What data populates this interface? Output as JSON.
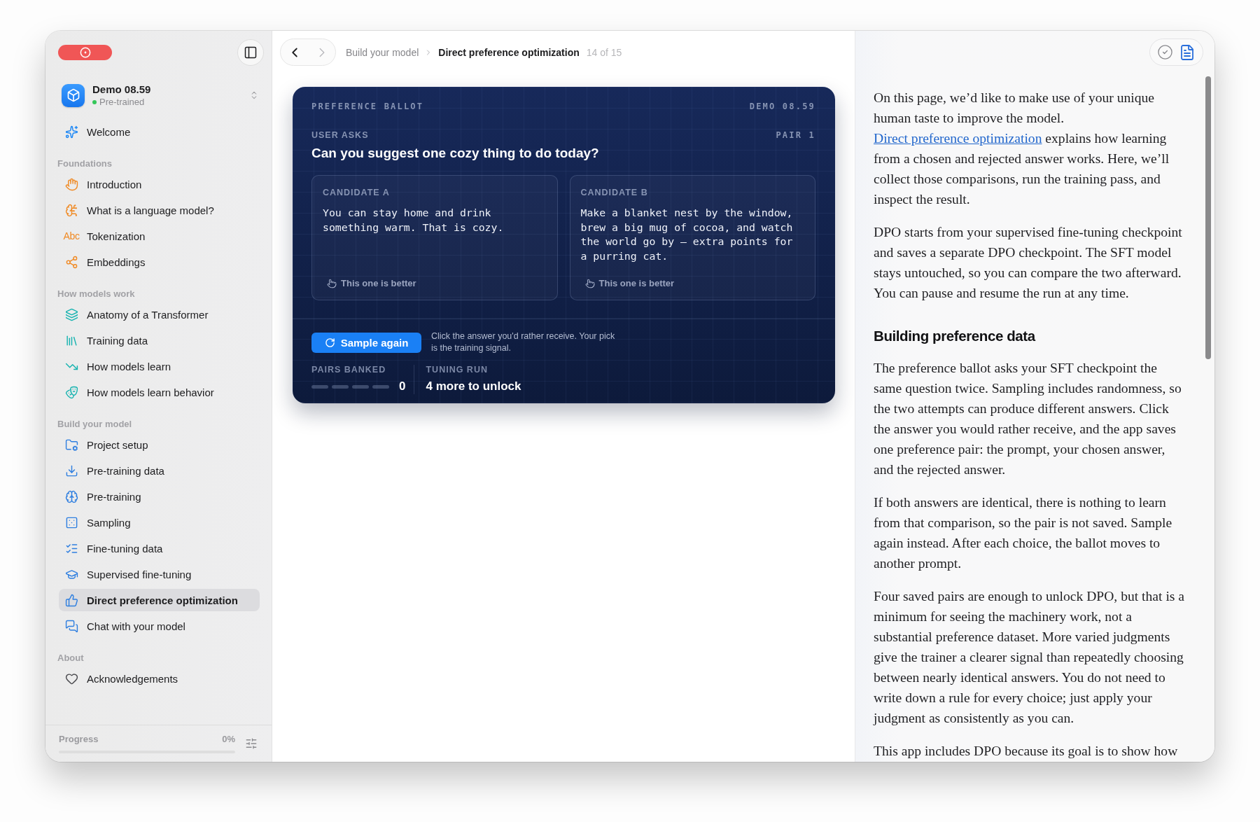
{
  "sidebar": {
    "project": {
      "name": "Demo 08.59",
      "status": {
        "label": "Pre-trained",
        "color": "#34c759"
      }
    },
    "welcome": {
      "label": "Welcome",
      "selected": false
    },
    "sections": [
      {
        "title": "Foundations",
        "color": "#f08a24",
        "items": [
          {
            "label": "Introduction",
            "selected": false
          },
          {
            "label": "What is a language model?",
            "selected": false
          },
          {
            "label": "Tokenization",
            "icon_text": "Abc",
            "selected": false
          },
          {
            "label": "Embeddings",
            "selected": false
          }
        ]
      },
      {
        "title": "How models work",
        "color": "#16b3b0",
        "items": [
          {
            "label": "Anatomy of a Transformer",
            "selected": false
          },
          {
            "label": "Training data",
            "selected": false
          },
          {
            "label": "How models learn",
            "selected": false
          },
          {
            "label": "How models learn behavior",
            "selected": false
          }
        ]
      },
      {
        "title": "Build your model",
        "color": "#2f7fe0",
        "items": [
          {
            "label": "Project setup",
            "selected": false
          },
          {
            "label": "Pre-training data",
            "selected": false
          },
          {
            "label": "Pre-training",
            "selected": false
          },
          {
            "label": "Sampling",
            "selected": false
          },
          {
            "label": "Fine-tuning data",
            "selected": false
          },
          {
            "label": "Supervised fine-tuning",
            "selected": false
          },
          {
            "label": "Direct preference optimization",
            "selected": true
          },
          {
            "label": "Chat with your model",
            "selected": false
          }
        ]
      },
      {
        "title": "About",
        "color": "#4a4a4e",
        "items": [
          {
            "label": "Acknowledgements",
            "selected": false
          }
        ]
      }
    ],
    "progress": {
      "label": "Progress",
      "value": "0%"
    }
  },
  "toolbar": {
    "nav": [
      {
        "kind": "back",
        "disabled": false
      },
      {
        "kind": "forward",
        "disabled": true
      }
    ],
    "breadcrumb": [
      {
        "label": "Build your model",
        "current": false
      },
      {
        "label": "Direct preference optimization",
        "current": true
      }
    ],
    "position": "14 of 15"
  },
  "ballot": {
    "title": "PREFERENCE BALLOT",
    "model": "DEMO 08.59",
    "prompt_label": "USER ASKS",
    "pair": "PAIR 1",
    "question": "Can you suggest one cozy thing to do today?",
    "candidates": [
      {
        "label": "CANDIDATE A",
        "text": "You can stay home and drink something warm. That is cozy.",
        "action": "This one is better",
        "selected": false
      },
      {
        "label": "CANDIDATE B",
        "text": "Make a blanket nest by the window, brew a big mug of cocoa, and watch the world go by — extra points for a purring cat.",
        "action": "This one is better",
        "selected": false
      }
    ],
    "sample_button": "Sample again",
    "hint": "Click the answer you'd rather receive. Your pick is the training signal.",
    "pairs_banked": {
      "label": "PAIRS BANKED",
      "count": "0"
    },
    "tuning_run": {
      "label": "TUNING RUN",
      "value": "4 more to unlock"
    }
  },
  "notes": {
    "tools": [
      {
        "kind": "complete",
        "selected": false
      },
      {
        "kind": "notes",
        "selected": true
      }
    ],
    "blocks": [
      {
        "kind": "paragraph",
        "segments": [
          {
            "kind": "text",
            "text": "On this page, we’d like to make use of your unique human taste to improve the model. "
          },
          {
            "kind": "link",
            "text": "Direct preference optimization"
          },
          {
            "kind": "text",
            "text": " explains how learning from a chosen and rejected answer works. Here, we’ll collect those comparisons, run the training pass, and inspect the result."
          }
        ]
      },
      {
        "kind": "paragraph",
        "segments": [
          {
            "kind": "text",
            "text": "DPO starts from your supervised fine-tuning checkpoint and saves a separate DPO checkpoint. The SFT model stays untouched, so you can compare the two afterward. You can pause and resume the run at any time."
          }
        ]
      },
      {
        "kind": "heading",
        "text": "Building preference data"
      },
      {
        "kind": "paragraph",
        "segments": [
          {
            "kind": "text",
            "text": "The preference ballot asks your SFT checkpoint the same question twice. Sampling includes randomness, so the two attempts can produce different answers. Click the answer you would rather receive, and the app saves one preference pair: the prompt, your chosen answer, and the rejected answer."
          }
        ]
      },
      {
        "kind": "paragraph",
        "segments": [
          {
            "kind": "text",
            "text": "If both answers are identical, there is nothing to learn from that comparison, so the pair is not saved. Sample again instead. After each choice, the ballot moves to another prompt."
          }
        ]
      },
      {
        "kind": "paragraph",
        "segments": [
          {
            "kind": "text",
            "text": "Four saved pairs are enough to unlock DPO, but that is a minimum for seeing the machinery work, not a substantial preference dataset. More varied judgments give the trainer a clearer signal than repeatedly choosing between nearly identical answers. You do not need to write down a rule for every choice; just apply your judgment as consistently as you can."
          }
        ]
      },
      {
        "kind": "paragraph",
        "segments": [
          {
            "kind": "text",
            "text": "This app includes DPO because its goal is to show how"
          }
        ]
      }
    ]
  }
}
